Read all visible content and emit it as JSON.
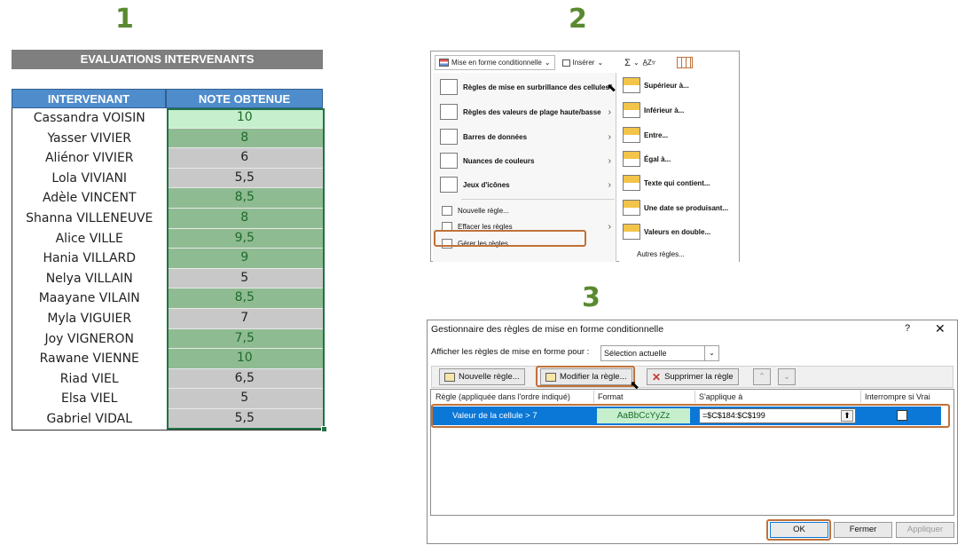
{
  "steps": {
    "one": "1",
    "two": "2",
    "three": "3"
  },
  "sheet": {
    "title": "EVALUATIONS INTERVENANTS",
    "headers": {
      "name": "INTERVENANT",
      "note": "NOTE OBTENUE"
    },
    "rows": [
      {
        "name": "Cassandra VOISIN",
        "note": "10",
        "style": "first"
      },
      {
        "name": "Yasser VIVIER",
        "note": "8",
        "style": "high"
      },
      {
        "name": "Aliénor VIVIER",
        "note": "6",
        "style": "low"
      },
      {
        "name": "Lola VIVIANI",
        "note": "5,5",
        "style": "low"
      },
      {
        "name": "Adèle VINCENT",
        "note": "8,5",
        "style": "high"
      },
      {
        "name": "Shanna VILLENEUVE",
        "note": "8",
        "style": "high"
      },
      {
        "name": "Alice VILLE",
        "note": "9,5",
        "style": "high"
      },
      {
        "name": "Hania VILLARD",
        "note": "9",
        "style": "high"
      },
      {
        "name": "Nelya VILLAIN",
        "note": "5",
        "style": "low"
      },
      {
        "name": "Maayane VILAIN",
        "note": "8,5",
        "style": "high"
      },
      {
        "name": "Myla VIGUIER",
        "note": "7",
        "style": "low"
      },
      {
        "name": "Joy VIGNERON",
        "note": "7,5",
        "style": "high"
      },
      {
        "name": "Rawane VIENNE",
        "note": "10",
        "style": "high"
      },
      {
        "name": "Riad VIEL",
        "note": "6,5",
        "style": "low"
      },
      {
        "name": "Elsa VIEL",
        "note": "5",
        "style": "low"
      },
      {
        "name": "Gabriel VIDAL",
        "note": "5,5",
        "style": "low"
      }
    ],
    "colors": {
      "header": "#4f8ccb",
      "high_fill": "#8fbb92",
      "low_fill": "#c8c8c8",
      "first_fill": "#c6efce"
    }
  },
  "ribbon": {
    "cond_format": "Mise en forme conditionnelle",
    "insert": "Insérer",
    "sum": "Σ",
    "sort": "A̲Z▿"
  },
  "menu": {
    "items": [
      {
        "label": "Règles de mise en surbrillance des cellules",
        "arrow": "›"
      },
      {
        "label": "Règles des valeurs de plage haute/basse",
        "arrow": "›"
      },
      {
        "label": "Barres de données",
        "arrow": "›"
      },
      {
        "label": "Nuances de couleurs",
        "arrow": "›"
      },
      {
        "label": "Jeux d'icônes",
        "arrow": "›"
      }
    ],
    "small_items": [
      {
        "label": "Nouvelle règle...",
        "arrow": ""
      },
      {
        "label": "Effacer les règles",
        "arrow": "›"
      },
      {
        "label": "Gérer les règles...",
        "arrow": ""
      }
    ],
    "submenu": [
      "Supérieur à...",
      "Inférieur à...",
      "Entre...",
      "Égal à...",
      "Texte qui contient...",
      "Une date se produisant...",
      "Valeurs en double..."
    ],
    "submenu_more": "Autres règles..."
  },
  "dialog": {
    "title": "Gestionnaire des règles de mise en forme conditionnelle",
    "help": "?",
    "close": "✕",
    "show_label": "Afficher les règles de mise en forme pour :",
    "show_value": "Sélection actuelle",
    "buttons": {
      "new_rule": "Nouvelle règle...",
      "edit_rule": "Modifier la règle...",
      "delete_rule": "Supprimer la règle",
      "up": "⌃",
      "down": "⌄"
    },
    "columns": {
      "rule": "Règle (appliquée dans l'ordre indiqué)",
      "format": "Format",
      "applies": "S'applique à",
      "stop": "Interrompre si Vrai"
    },
    "rule": {
      "name": "Valeur de la cellule > 7",
      "format_preview": "AaBbCcYyZz",
      "applies_to": "=$C$184:$C$199"
    },
    "footer": {
      "ok": "OK",
      "close": "Fermer",
      "apply": "Appliquer"
    }
  }
}
